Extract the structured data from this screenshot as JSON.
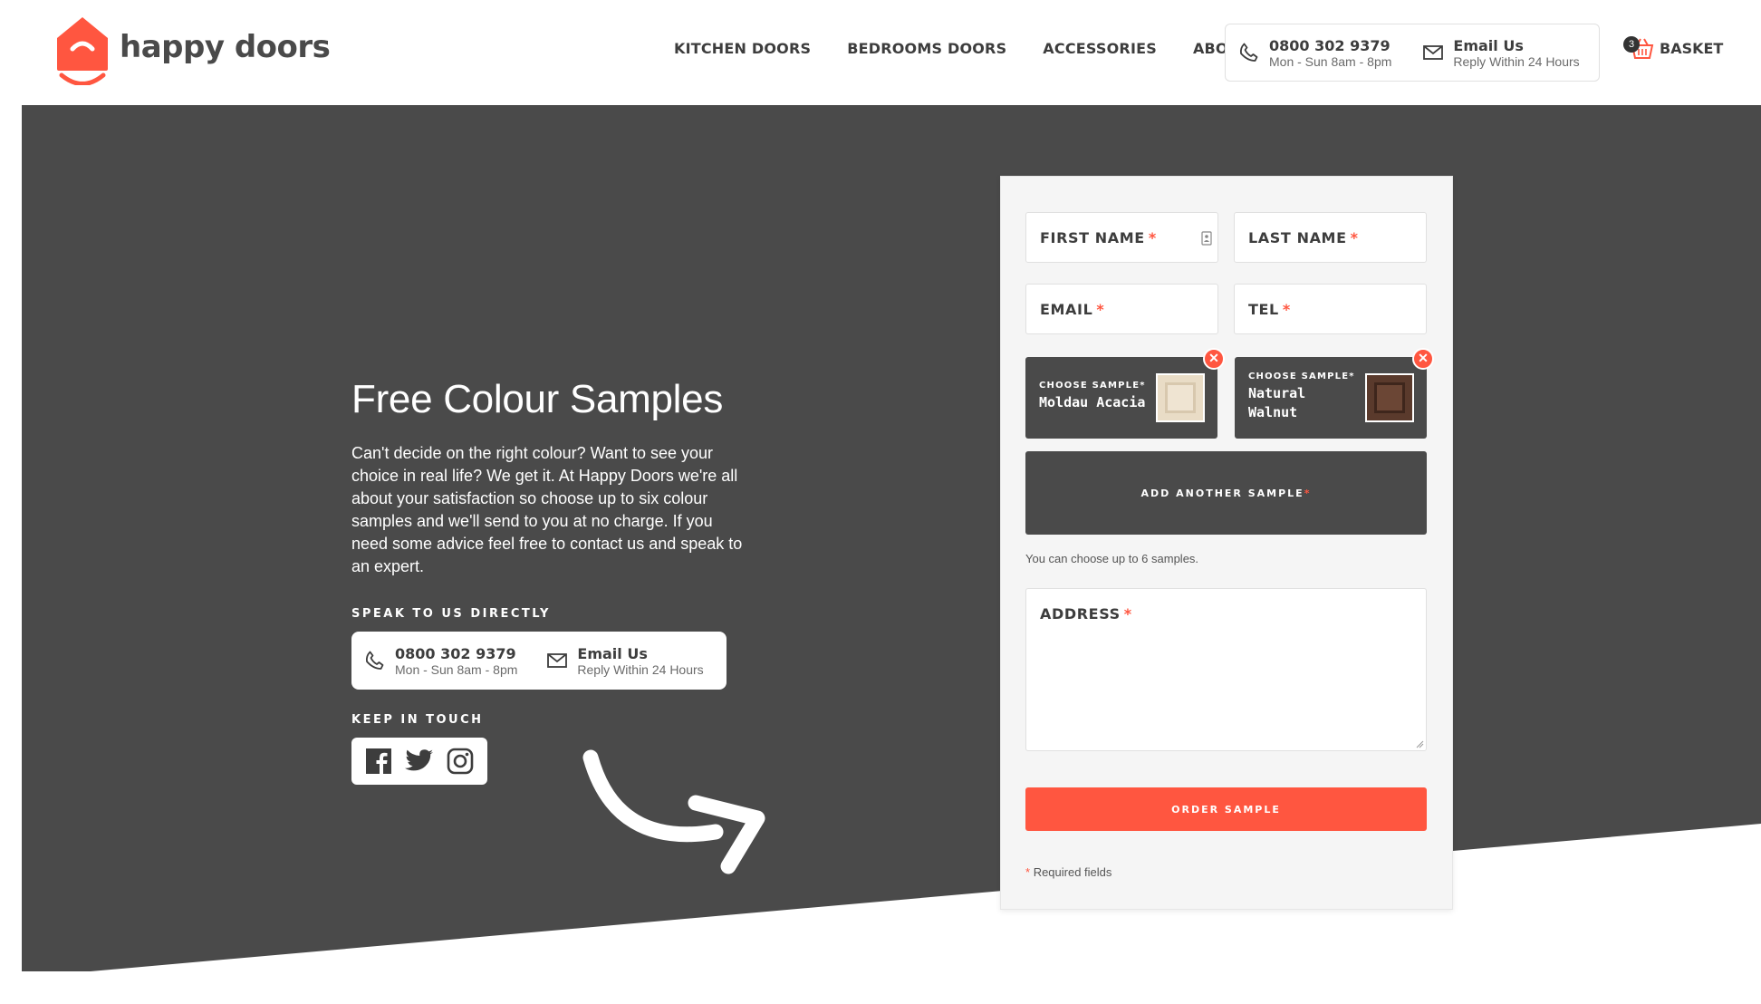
{
  "brand": {
    "name": "happy doors",
    "accent": "#ff5640",
    "dark": "#4a4a4a"
  },
  "nav": [
    {
      "label": "KITCHEN DOORS"
    },
    {
      "label": "BEDROOMS DOORS"
    },
    {
      "label": "ACCESSORIES"
    },
    {
      "label": "ABOUT"
    }
  ],
  "header_contact": {
    "phone": "0800 302 9379",
    "phone_hours": "Mon - Sun 8am - 8pm",
    "email_label": "Email Us",
    "email_sub": "Reply Within 24 Hours"
  },
  "basket": {
    "label": "BASKET",
    "count": "3"
  },
  "hero": {
    "title": "Free Colour Samples",
    "description": "Can't decide on the right colour? Want to see your choice in real life? We get it. At Happy Doors we're all about your satisfaction so choose up to six colour samples and we'll send to you at no charge. If you need some advice feel free to contact us and speak to an expert.",
    "speak_label": "SPEAK TO US DIRECTLY",
    "speak_phone": "0800 302 9379",
    "speak_hours": "Mon - Sun 8am - 8pm",
    "speak_email": "Email Us",
    "speak_email_sub": "Reply Within 24 Hours",
    "keep_label": "KEEP IN TOUCH",
    "social": [
      "facebook-icon",
      "twitter-icon",
      "instagram-icon"
    ]
  },
  "form": {
    "first_name": "FIRST NAME",
    "last_name": "LAST NAME",
    "email": "EMAIL",
    "tel": "TEL",
    "required_mark": "*",
    "samples": [
      {
        "label": "CHOOSE SAMPLE",
        "name": "Moldau Acacia"
      },
      {
        "label": "CHOOSE SAMPLE",
        "name": "Natural Walnut"
      }
    ],
    "remove_glyph": "✕",
    "add_sample": "ADD ANOTHER SAMPLE",
    "sample_note": "You can choose up to 6 samples.",
    "address": "ADDRESS",
    "order_button": "ORDER SAMPLE",
    "required_note": "Required fields"
  }
}
